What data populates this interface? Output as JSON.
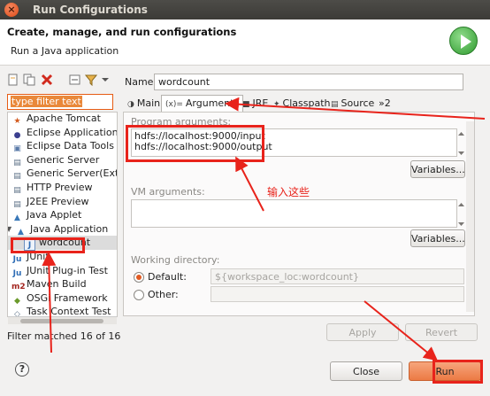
{
  "window": {
    "title": "Run Configurations",
    "close_glyph": "×"
  },
  "header": {
    "title": "Create, manage, and run configurations",
    "subtitle": "Run a Java application"
  },
  "toolbar": {
    "icons": [
      "new-config-icon",
      "duplicate-icon",
      "delete-icon",
      "collapse-all-icon",
      "filter-icon",
      "menu-chevron-icon"
    ]
  },
  "filter": {
    "placeholder": "type filter text"
  },
  "tree": {
    "items": [
      {
        "label": "Apache Tomcat",
        "icon": "tomcat-icon",
        "glyph": "★",
        "color": "#d35a1e"
      },
      {
        "label": "Eclipse Application",
        "icon": "eclipse-icon",
        "glyph": "●",
        "color": "#3b3f8f"
      },
      {
        "label": "Eclipse Data Tools",
        "icon": "data-tools-icon",
        "glyph": "▣",
        "color": "#5a7aa8"
      },
      {
        "label": "Generic Server",
        "icon": "server-icon",
        "glyph": "▤",
        "color": "#5b6f86"
      },
      {
        "label": "Generic Server(Extern",
        "icon": "server-icon",
        "glyph": "▤",
        "color": "#5b6f86"
      },
      {
        "label": "HTTP Preview",
        "icon": "http-preview-icon",
        "glyph": "▤",
        "color": "#5b6f86"
      },
      {
        "label": "J2EE Preview",
        "icon": "j2ee-preview-icon",
        "glyph": "▤",
        "color": "#5b6f86"
      },
      {
        "label": "Java Applet",
        "icon": "java-applet-icon",
        "glyph": "▲",
        "color": "#3a78b8"
      },
      {
        "label": "Java Application",
        "icon": "java-application-icon",
        "glyph": "▲",
        "color": "#3a78b8",
        "expanded": true
      },
      {
        "label": "wordcount",
        "icon": "java-class-icon",
        "glyph": "J",
        "color": "#2f6db5",
        "child": true,
        "selected": true
      },
      {
        "label": "JUnit",
        "icon": "junit-icon",
        "glyph": "Ju",
        "color": "#2f6db5"
      },
      {
        "label": "JUnit Plug-in Test",
        "icon": "junit-plugin-icon",
        "glyph": "Ju",
        "color": "#2f6db5"
      },
      {
        "label": "Maven Build",
        "icon": "maven-icon",
        "glyph": "m2",
        "color": "#a3251f"
      },
      {
        "label": "OSGi Framework",
        "icon": "osgi-icon",
        "glyph": "◆",
        "color": "#6b9a2b"
      },
      {
        "label": "Task Context Test",
        "icon": "task-context-icon",
        "glyph": "◇",
        "color": "#5b6f86"
      }
    ],
    "status": "Filter matched 16 of 16 items"
  },
  "name": {
    "label": "Name:",
    "value": "wordcount"
  },
  "tabs": [
    {
      "label": "Main",
      "icon": "main-tab-icon",
      "glyph": "◑"
    },
    {
      "label": "Arguments",
      "icon": "arguments-tab-icon",
      "glyph": "(x)=",
      "active": true
    },
    {
      "label": "JRE",
      "icon": "jre-tab-icon",
      "glyph": "■"
    },
    {
      "label": "Classpath",
      "icon": "classpath-tab-icon",
      "glyph": "✦"
    },
    {
      "label": "Source",
      "icon": "source-tab-icon",
      "glyph": "▤"
    },
    {
      "label": "»2",
      "icon": "more-tabs-icon",
      "glyph": ""
    }
  ],
  "arguments": {
    "program_label": "Program arguments:",
    "program_value": "hdfs://localhost:9000/input\nhdfs://localhost:9000/output",
    "variables_label": "Variables...",
    "vm_label": "VM arguments:",
    "vm_value": "",
    "vm_variables_label": "Variables...",
    "working_dir_label": "Working directory:",
    "default_label": "Default:",
    "default_value": "${workspace_loc:wordcount}",
    "other_label": "Other:"
  },
  "annotation": {
    "text": "输入这些",
    "color": "#e8231b"
  },
  "buttons": {
    "apply": "Apply",
    "revert": "Revert",
    "close": "Close",
    "run": "Run"
  },
  "colors": {
    "accent": "#e15a22",
    "run_button": "#f08a5a",
    "annotation": "#e8231b"
  }
}
